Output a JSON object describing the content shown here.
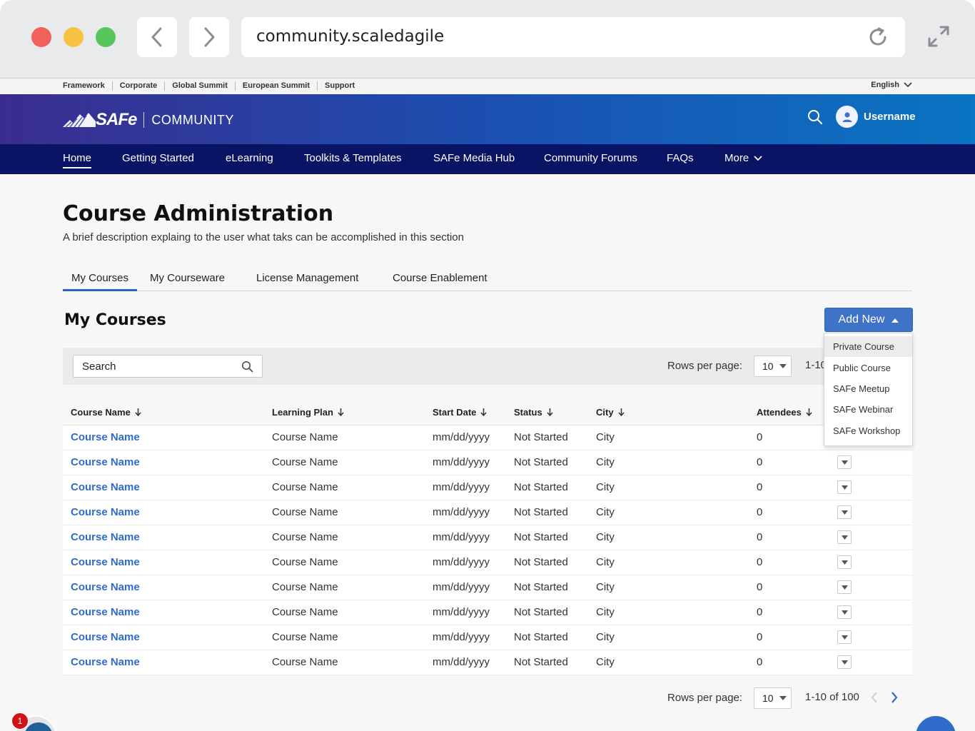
{
  "browser": {
    "url": "community.scaledagile"
  },
  "utility_bar": {
    "links": [
      "Framework",
      "Corporate",
      "Global Summit",
      "European Summit",
      "Support"
    ],
    "language": "English"
  },
  "header": {
    "logo_mark": "SAFe",
    "logo_text": "COMMUNITY",
    "username": "Username"
  },
  "main_nav": {
    "items": [
      "Home",
      "Getting Started",
      "eLearning",
      "Toolkits & Templates",
      "SAFe Media Hub",
      "Community Forums",
      "FAQs",
      "More"
    ],
    "active": "Home"
  },
  "page": {
    "title": "Course Administration",
    "description": "A brief description explaing to the user what taks can be accomplished in this section"
  },
  "tabs": {
    "items": [
      "My Courses",
      "My Courseware",
      "License Management",
      "Course Enablement"
    ],
    "active": "My Courses"
  },
  "section": {
    "title": "My Courses",
    "add_new_label": "Add New"
  },
  "add_new_menu": {
    "items": [
      "Private Course",
      "Public Course",
      "SAFe Meetup",
      "SAFe Webinar",
      "SAFe Workshop"
    ],
    "highlighted": "Private Course"
  },
  "toolbar": {
    "search_placeholder": "Search",
    "rows_per_page_label": "Rows per page:",
    "rows_per_page_value": "10",
    "range_text": "1-10"
  },
  "table": {
    "headers": [
      "Course Name",
      "Learning Plan",
      "Start Date",
      "Status",
      "City",
      "Attendees"
    ],
    "rows": [
      [
        "Course Name",
        "Course Name",
        "mm/dd/yyyy",
        "Not Started",
        "City",
        "0"
      ],
      [
        "Course Name",
        "Course Name",
        "mm/dd/yyyy",
        "Not Started",
        "City",
        "0"
      ],
      [
        "Course Name",
        "Course Name",
        "mm/dd/yyyy",
        "Not Started",
        "City",
        "0"
      ],
      [
        "Course Name",
        "Course Name",
        "mm/dd/yyyy",
        "Not Started",
        "City",
        "0"
      ],
      [
        "Course Name",
        "Course Name",
        "mm/dd/yyyy",
        "Not Started",
        "City",
        "0"
      ],
      [
        "Course Name",
        "Course Name",
        "mm/dd/yyyy",
        "Not Started",
        "City",
        "0"
      ],
      [
        "Course Name",
        "Course Name",
        "mm/dd/yyyy",
        "Not Started",
        "City",
        "0"
      ],
      [
        "Course Name",
        "Course Name",
        "mm/dd/yyyy",
        "Not Started",
        "City",
        "0"
      ],
      [
        "Course Name",
        "Course Name",
        "mm/dd/yyyy",
        "Not Started",
        "City",
        "0"
      ],
      [
        "Course Name",
        "Course Name",
        "mm/dd/yyyy",
        "Not Started",
        "City",
        "0"
      ]
    ]
  },
  "pagination": {
    "rows_per_page_label": "Rows per page:",
    "rows_per_page_value": "10",
    "range_text": "1-10 of 100"
  },
  "notification": {
    "count": "1"
  },
  "colors": {
    "nav_bg": "#0a1464",
    "accent": "#2f6cc9",
    "button": "#3f73c8",
    "badge": "#d0121b"
  }
}
